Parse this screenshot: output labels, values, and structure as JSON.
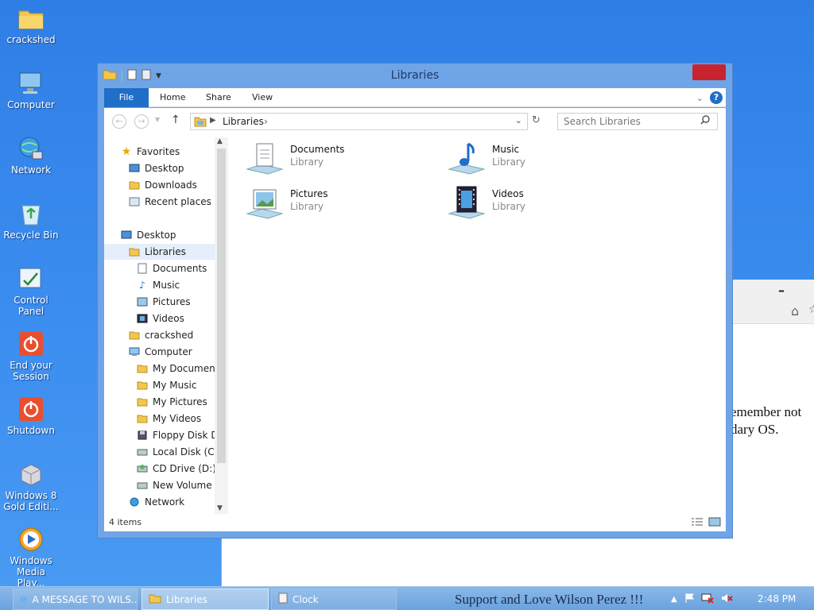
{
  "desktop": {
    "icons": [
      {
        "label": "crackshed",
        "icon": "folder-icon"
      },
      {
        "label": "Computer",
        "icon": "computer-icon"
      },
      {
        "label": "Network",
        "icon": "network-icon"
      },
      {
        "label": "Recycle Bin",
        "icon": "recycle-bin-icon"
      },
      {
        "label": "Control Panel",
        "icon": "control-panel-icon"
      },
      {
        "label": "End your Session",
        "icon": "power-icon"
      },
      {
        "label": "Shutdown",
        "icon": "power-icon"
      },
      {
        "label": "Windows 8 Gold Editi...",
        "icon": "installer-icon"
      },
      {
        "label": "Windows Media Play...",
        "icon": "media-player-icon"
      }
    ]
  },
  "background_window": {
    "minimize_label": "–",
    "text_line1": "emember not",
    "text_line2": "dary OS."
  },
  "explorer": {
    "title": "Libraries",
    "ribbon": {
      "file": "File",
      "home": "Home",
      "share": "Share",
      "view": "View",
      "help": "?"
    },
    "address": {
      "crumb": "Libraries",
      "separator": "›"
    },
    "search": {
      "placeholder": "Search Libraries"
    },
    "nav": [
      {
        "label": "Favorites",
        "icon": "star-icon"
      },
      {
        "label": "Desktop",
        "icon": "desktop-icon"
      },
      {
        "label": "Downloads",
        "icon": "downloads-icon"
      },
      {
        "label": "Recent places",
        "icon": "recent-places-icon"
      },
      {
        "label": "Desktop",
        "icon": "desktop-icon"
      },
      {
        "label": "Libraries",
        "icon": "libraries-icon"
      },
      {
        "label": "Documents",
        "icon": "documents-icon"
      },
      {
        "label": "Music",
        "icon": "music-icon"
      },
      {
        "label": "Pictures",
        "icon": "pictures-icon"
      },
      {
        "label": "Videos",
        "icon": "videos-icon"
      },
      {
        "label": "crackshed",
        "icon": "folder-icon"
      },
      {
        "label": "Computer",
        "icon": "computer-icon"
      },
      {
        "label": "My Documents",
        "icon": "folder-icon"
      },
      {
        "label": "My Music",
        "icon": "folder-icon"
      },
      {
        "label": "My Pictures",
        "icon": "folder-icon"
      },
      {
        "label": "My Videos",
        "icon": "folder-icon"
      },
      {
        "label": "Floppy Disk Dri",
        "icon": "floppy-icon"
      },
      {
        "label": "Local Disk (C:)",
        "icon": "disk-icon"
      },
      {
        "label": "CD Drive (D:) W",
        "icon": "cd-drive-icon"
      },
      {
        "label": "New Volume (E",
        "icon": "disk-icon"
      },
      {
        "label": "Network",
        "icon": "network-icon"
      }
    ],
    "libraries": [
      {
        "name": "Documents",
        "type": "Library",
        "icon": "documents-library-icon"
      },
      {
        "name": "Music",
        "type": "Library",
        "icon": "music-library-icon"
      },
      {
        "name": "Pictures",
        "type": "Library",
        "icon": "pictures-library-icon"
      },
      {
        "name": "Videos",
        "type": "Library",
        "icon": "videos-library-icon"
      }
    ],
    "status": "4 items"
  },
  "taskbar": {
    "buttons": [
      {
        "label": "A MESSAGE TO WILS...",
        "icon": "ie-icon"
      },
      {
        "label": "Libraries",
        "icon": "folder-icon"
      },
      {
        "label": "Clock",
        "icon": "document-icon"
      }
    ],
    "marquee": "Support and Love Wilson Perez !!!",
    "clock": "2:48 PM"
  },
  "colors": {
    "accent": "#1f6ec8",
    "close": "#c7242f",
    "desktop": "#3c8ef0"
  }
}
